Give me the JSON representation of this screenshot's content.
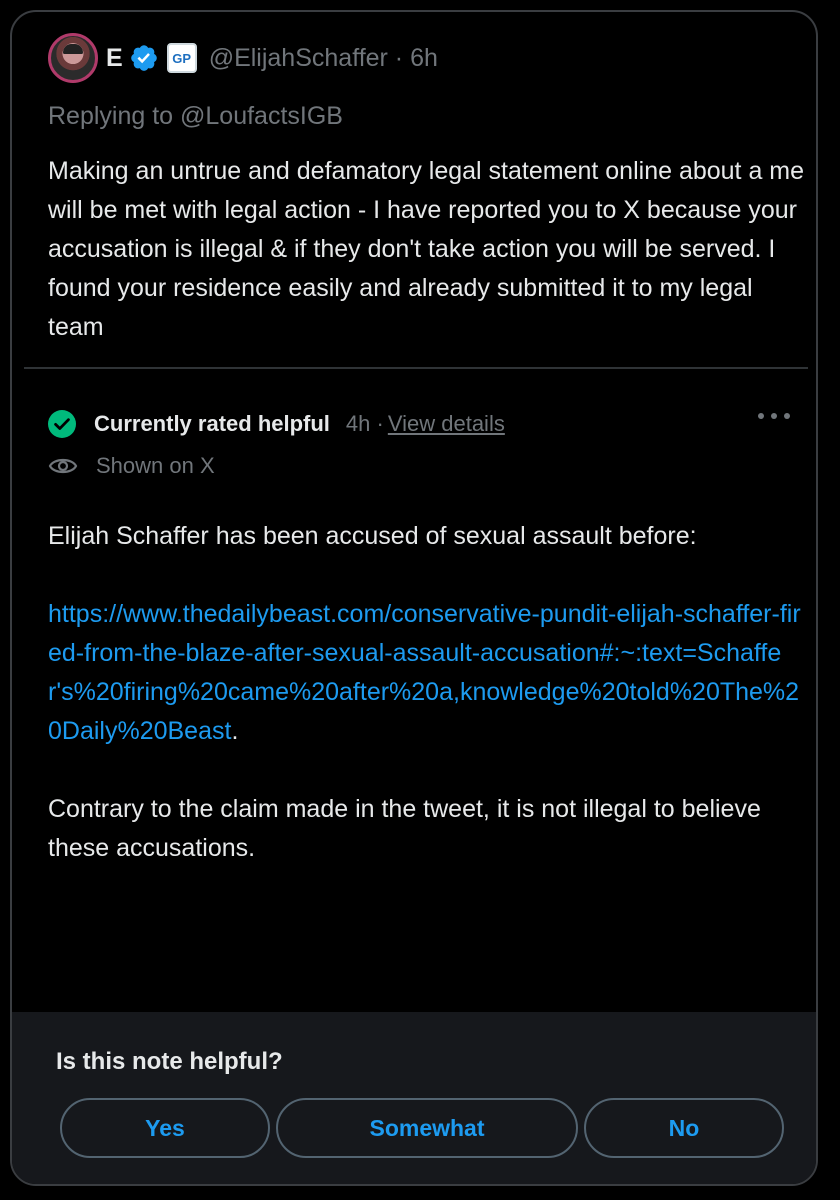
{
  "tweet": {
    "display_name": "E",
    "affiliation_badge": "GP",
    "handle_time": "@ElijahSchaffer · 6h",
    "replying_to": "Replying to @LoufactsIGB",
    "text": "Making an untrue and defamatory legal statement online about a me will be met with legal action - I have reported you to X because your accusation is illegal & if they don't take action you will be served. I found your residence easily and already submitted it to my legal team"
  },
  "note": {
    "status_label": "Currently rated helpful",
    "status_time": "4h ·",
    "view_details": "View details",
    "shown_on": "Shown on X",
    "paragraph1": "Elijah Schaffer has been accused of sexual assault before:",
    "link": "https://www.thedailybeast.com/conservative-pundit-elijah-schaffer-fired-from-the-blaze-after-sexual-assault-accusation#:~:text=Schaffer's%20firing%20came%20after%20a,knowledge%20told%20The%20Daily%20Beast",
    "link_suffix": ".",
    "paragraph2": "Contrary to the claim made in the tweet, it is not illegal to believe these accusations."
  },
  "feedback": {
    "question": "Is this note helpful?",
    "yes": "Yes",
    "somewhat": "Somewhat",
    "no": "No"
  },
  "colors": {
    "background": "#000000",
    "text": "#e7e9ea",
    "muted": "#71767b",
    "link": "#1d9bf0",
    "helpful_green": "#00ba7c",
    "panel": "#16181c"
  },
  "icons": [
    "avatar",
    "verified-badge-icon",
    "affiliation-badge",
    "check-circle-icon",
    "eye-icon",
    "more-icon"
  ]
}
